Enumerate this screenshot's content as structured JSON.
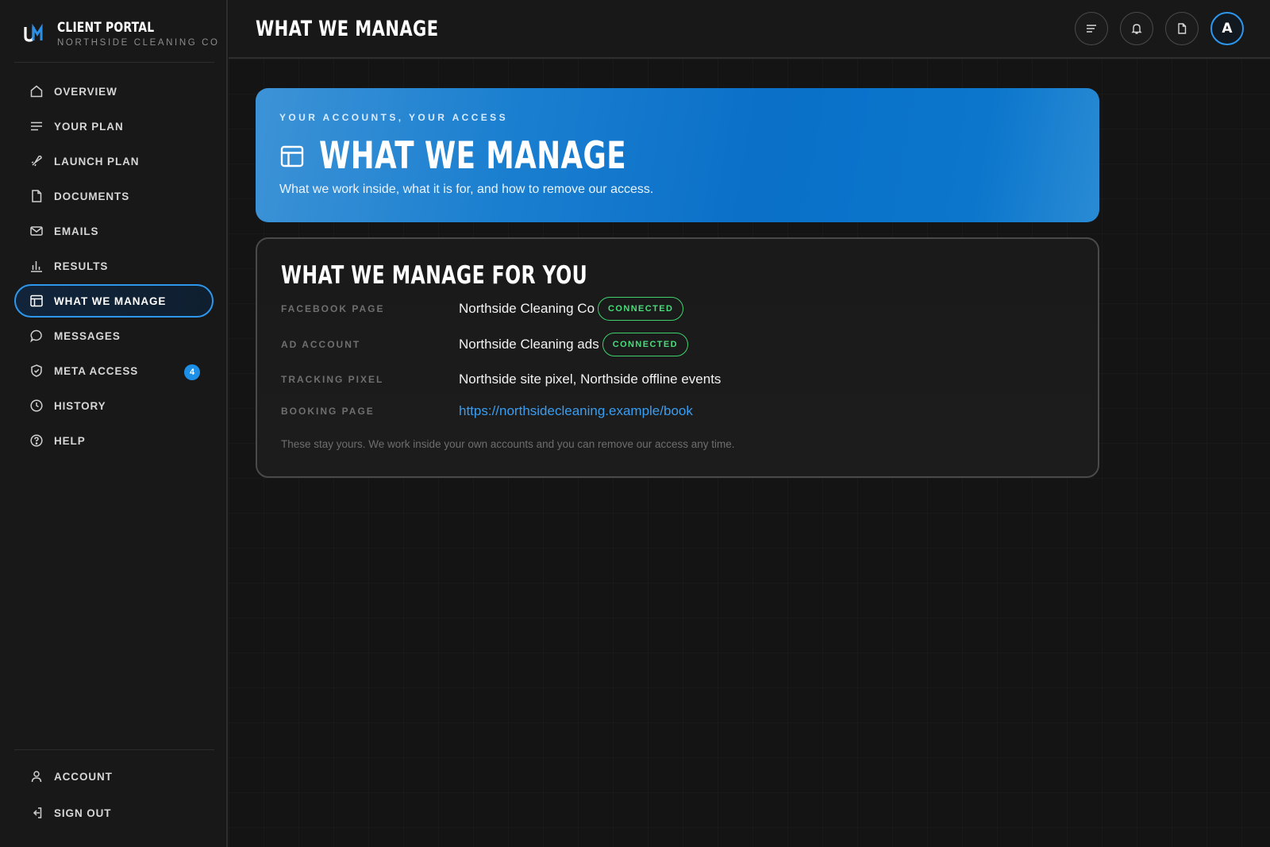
{
  "brand": {
    "logo_text": "UM",
    "title": "CLIENT PORTAL",
    "subtitle": "NORTHSIDE CLEANING CO"
  },
  "sidebar": {
    "items": [
      {
        "label": "OVERVIEW",
        "icon": "home-icon"
      },
      {
        "label": "YOUR PLAN",
        "icon": "lines-icon"
      },
      {
        "label": "LAUNCH PLAN",
        "icon": "rocket-icon"
      },
      {
        "label": "DOCUMENTS",
        "icon": "document-icon"
      },
      {
        "label": "EMAILS",
        "icon": "mail-icon"
      },
      {
        "label": "RESULTS",
        "icon": "bar-chart-icon"
      },
      {
        "label": "WHAT WE MANAGE",
        "icon": "layout-icon",
        "active": true
      },
      {
        "label": "MESSAGES",
        "icon": "chat-icon"
      },
      {
        "label": "META ACCESS",
        "icon": "shield-icon",
        "badge": "4"
      },
      {
        "label": "HISTORY",
        "icon": "clock-icon"
      },
      {
        "label": "HELP",
        "icon": "help-icon"
      }
    ],
    "bottom": [
      {
        "label": "ACCOUNT",
        "icon": "user-icon"
      },
      {
        "label": "SIGN OUT",
        "icon": "sign-out-icon"
      }
    ]
  },
  "topbar": {
    "title": "WHAT WE MANAGE",
    "avatar_letter": "A",
    "icons": [
      "menu-icon",
      "bell-icon",
      "document-icon"
    ]
  },
  "hero": {
    "eyebrow": "YOUR ACCOUNTS, YOUR ACCESS",
    "title": "WHAT WE MANAGE",
    "subtitle": "What we work inside, what it is for, and how to remove our access."
  },
  "card": {
    "title": "WHAT WE MANAGE FOR YOU",
    "rows": [
      {
        "label": "FACEBOOK PAGE",
        "value": "Northside Cleaning Co",
        "status": "CONNECTED"
      },
      {
        "label": "AD ACCOUNT",
        "value": "Northside Cleaning ads",
        "status": "CONNECTED"
      },
      {
        "label": "TRACKING PIXEL",
        "value": "Northside site pixel, Northside offline events"
      },
      {
        "label": "BOOKING PAGE",
        "value": "https://northsidecleaning.example/book"
      }
    ],
    "note": "These stay yours. We work inside your own accounts and you can remove our access any time."
  },
  "colors": {
    "accent": "#2c97ec",
    "connected": "#48dd7a",
    "background": "#151515"
  }
}
